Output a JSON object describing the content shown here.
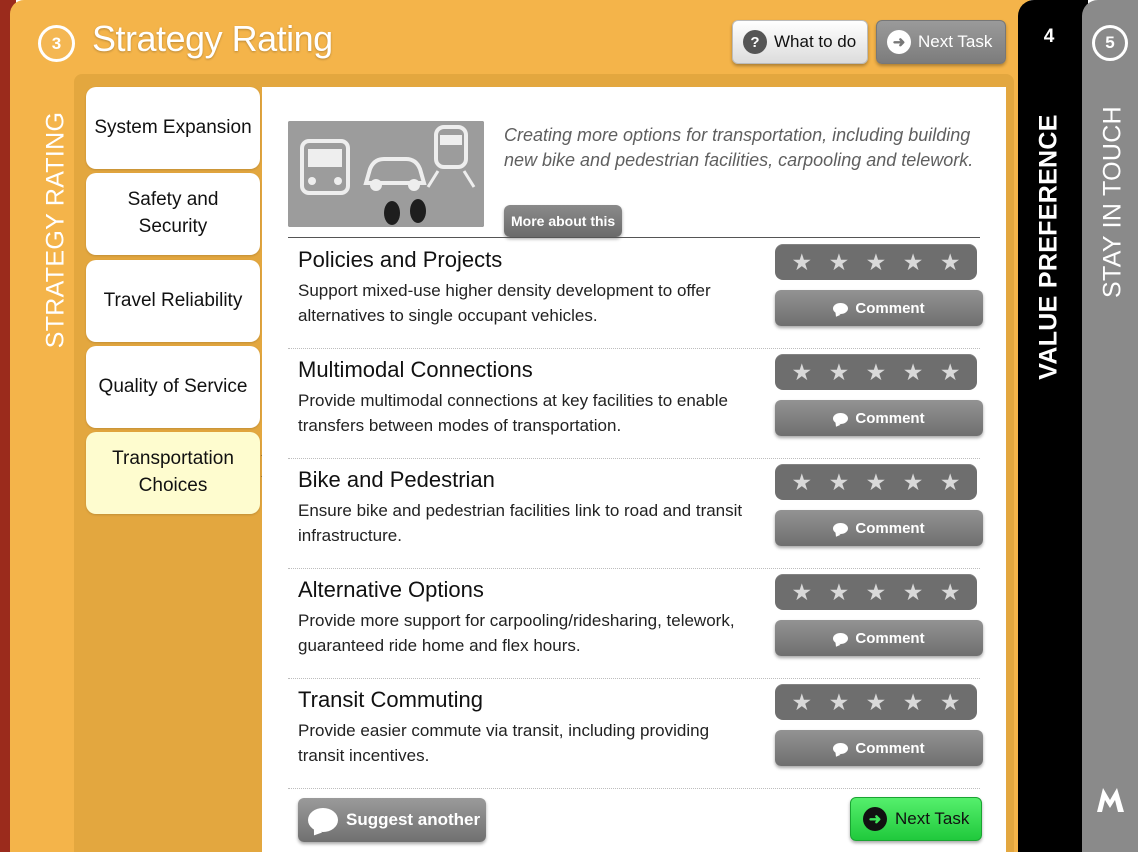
{
  "header": {
    "step_number": "3",
    "title": "Strategy Rating",
    "what_to_do_label": "What to do",
    "what_to_do_icon": "?",
    "next_task_label": "Next Task"
  },
  "side_label": "STRATEGY RATING",
  "categories": [
    {
      "label": "System Expansion"
    },
    {
      "label": "Safety and Security"
    },
    {
      "label": "Travel Reliability"
    },
    {
      "label": "Quality of Service"
    },
    {
      "label": "Transportation Choices",
      "active": true
    }
  ],
  "hero": {
    "image": "transportation-options-photo",
    "description": "Creating more options for transportation, including building new bike and pedestrian facilities, carpooling and telework.",
    "more_label": "More about this"
  },
  "items": [
    {
      "title": "Policies and Projects",
      "description": "Support mixed-use higher density development to offer alternatives to single occupant vehicles.",
      "rating": 0,
      "comment_label": "Comment"
    },
    {
      "title": "Multimodal Connections",
      "description": "Provide multimodal connections at key facilities to enable transfers between modes of transportation.",
      "rating": 0,
      "comment_label": "Comment"
    },
    {
      "title": "Bike and Pedestrian",
      "description": "Ensure bike and pedestrian facilities link to road and transit infrastructure.",
      "rating": 0,
      "comment_label": "Comment"
    },
    {
      "title": "Alternative Options",
      "description": "Provide more support for carpooling/ridesharing, telework, guaranteed ride home and flex hours.",
      "rating": 0,
      "comment_label": "Comment"
    },
    {
      "title": "Transit Commuting",
      "description": "Provide easier commute via transit, including providing transit incentives.",
      "rating": 0,
      "comment_label": "Comment"
    }
  ],
  "footer": {
    "suggest_label": "Suggest another",
    "next_task_label": "Next Task"
  },
  "panel4": {
    "number": "4",
    "label": "VALUE PREFERENCE"
  },
  "panel5": {
    "number": "5",
    "label": "STAY IN TOUCH",
    "logo": "m-logo"
  },
  "colors": {
    "orange": "#f4b44a",
    "inner_orange": "#e3a73f",
    "active_tab": "#fefccf",
    "green_button": "#3ee55a",
    "star_bar": "#6e6e6e"
  }
}
